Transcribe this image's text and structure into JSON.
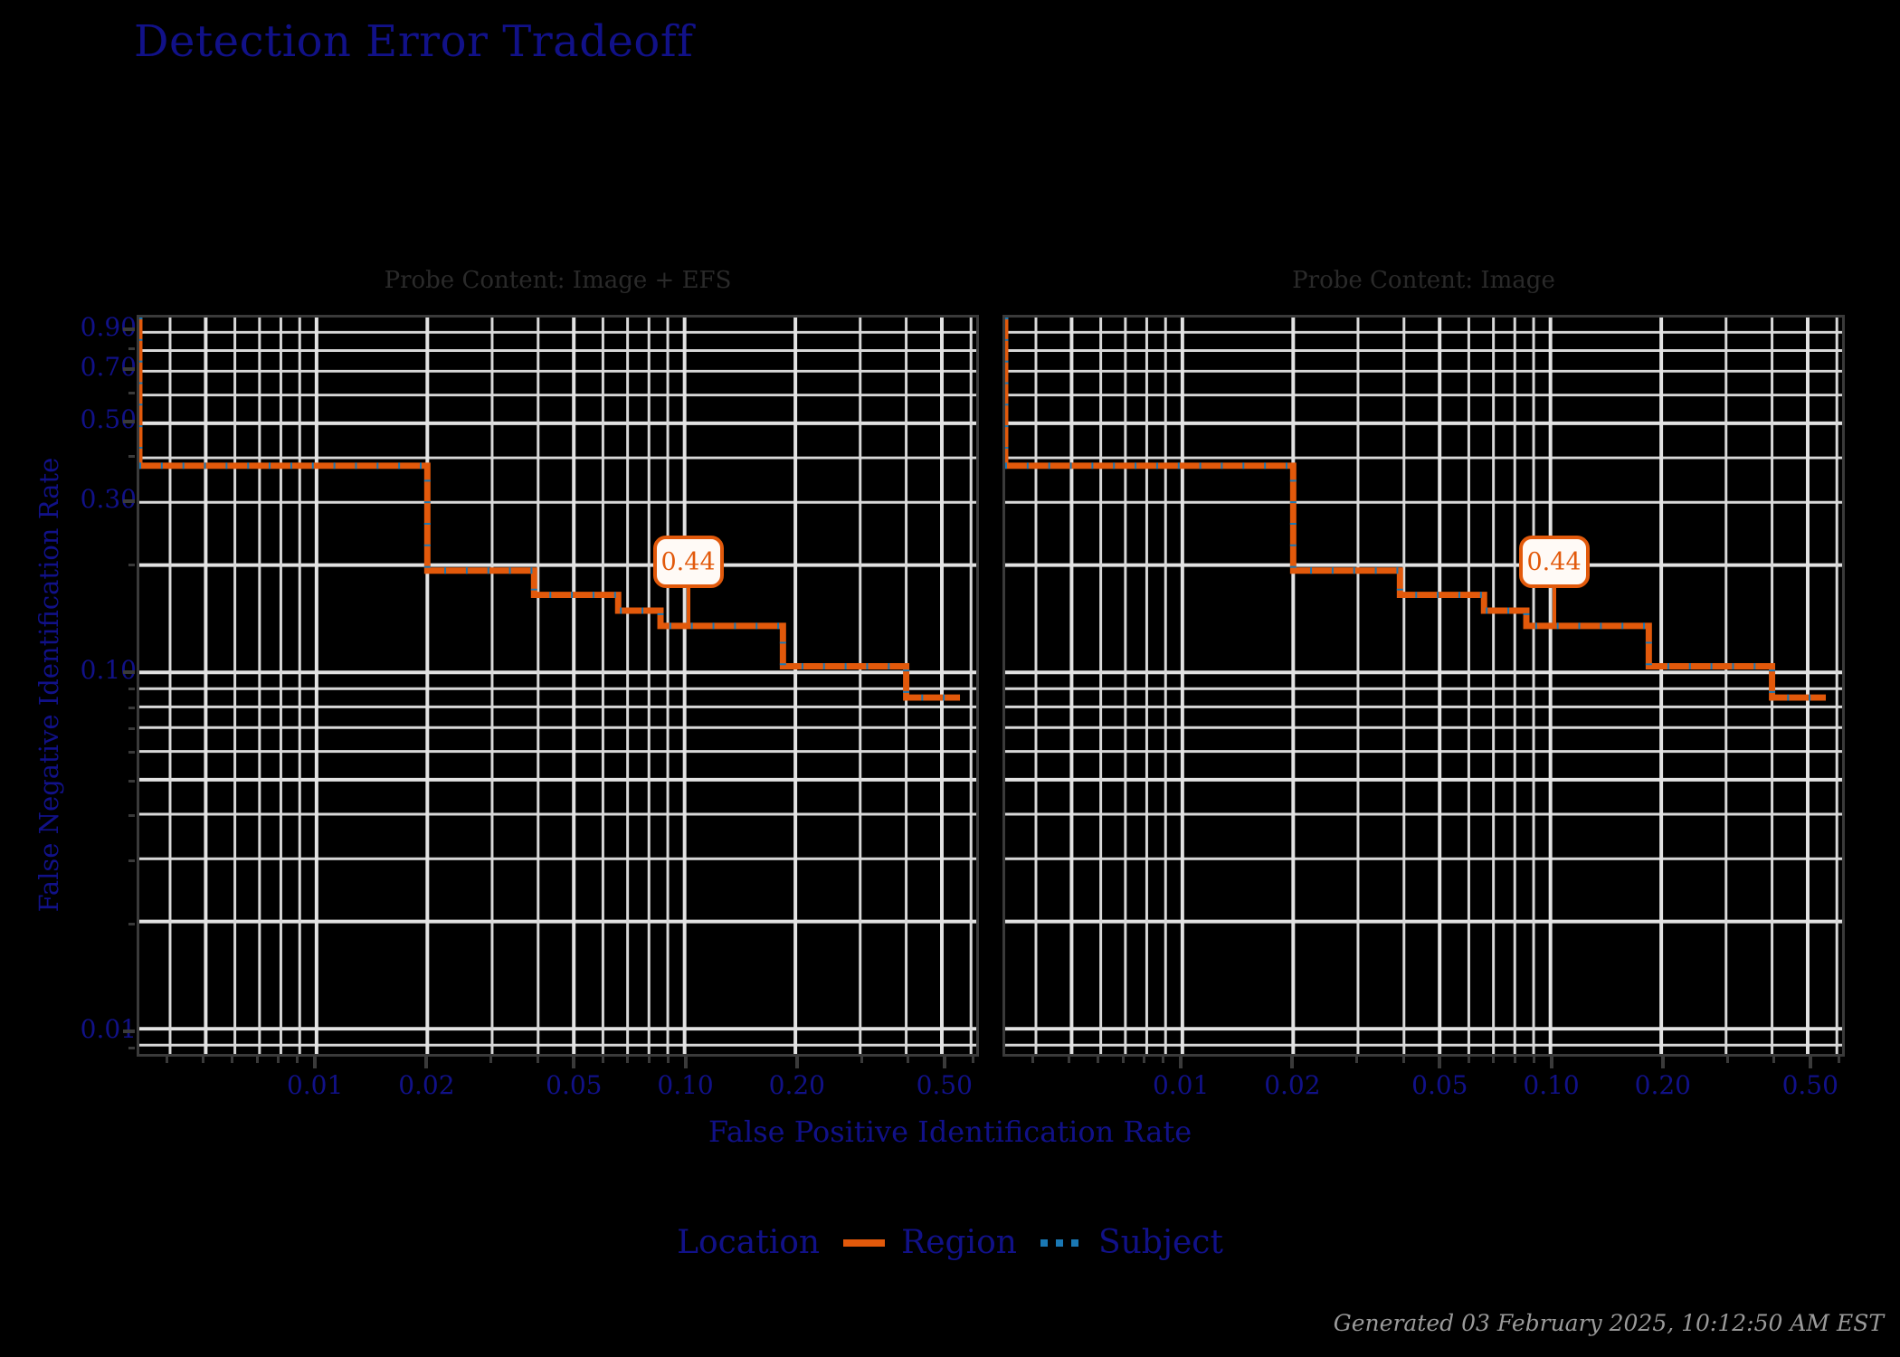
{
  "title": "Detection Error Tradeoff",
  "axes": {
    "x_title": "False Positive Identification Rate",
    "y_title": "False Negative Identification Rate",
    "x_ticks": [
      "0.01",
      "0.02",
      "0.05",
      "0.10",
      "0.20",
      "0.50"
    ],
    "y_ticks": [
      "0.90",
      "0.70",
      "0.50",
      "0.30",
      "0.10",
      "0.01"
    ]
  },
  "panels": [
    {
      "title": "Probe Content: Image + EFS"
    },
    {
      "title": "Probe Content: Image"
    }
  ],
  "legend": {
    "title": "Location",
    "items": [
      {
        "label": "Region",
        "style": "solid",
        "color": "#e2590b"
      },
      {
        "label": "Subject",
        "style": "dotted",
        "color": "#1a78b4"
      }
    ]
  },
  "annotation": {
    "label": "0.44"
  },
  "footer": "Generated 03 February 2025, 10:12:50 AM EST",
  "colors": {
    "title": "#111188",
    "axis_text": "#111188",
    "panel_title": "#2a2a2a",
    "background": "#000000",
    "grid": "#e2e2e2",
    "region": "#e2590b",
    "subject": "#1a78b4",
    "footer": "#9a9a9a"
  },
  "chart_data": {
    "type": "line",
    "title": "Detection Error Tradeoff",
    "xlabel": "False Positive Identification Rate",
    "ylabel": "False Negative Identification Rate",
    "xscale": "log",
    "yscale": "log",
    "xlim": [
      0.0033,
      0.62
    ],
    "ylim": [
      0.0085,
      0.99
    ],
    "grid": true,
    "legend_position": "bottom",
    "annotations": [
      {
        "text": "0.44",
        "x": 0.1,
        "y": 0.135,
        "panel": 0
      },
      {
        "text": "0.44",
        "x": 0.1,
        "y": 0.135,
        "panel": 1
      }
    ],
    "panels": [
      {
        "name": "Probe Content: Image + EFS",
        "series": [
          {
            "name": "Region",
            "style": "solid",
            "color": "#e2590b",
            "step": "post",
            "x": [
              0.0033,
              0.02,
              0.02,
              0.039,
              0.039,
              0.066,
              0.066,
              0.086,
              0.086,
              0.185,
              0.185,
              0.4,
              0.4,
              0.56
            ],
            "y": [
              0.38,
              0.38,
              0.193,
              0.193,
              0.165,
              0.165,
              0.149,
              0.149,
              0.135,
              0.135,
              0.104,
              0.104,
              0.085,
              0.085
            ]
          },
          {
            "name": "Subject",
            "style": "dotted",
            "color": "#1a78b4",
            "step": "post",
            "x": [
              0.0033,
              0.02,
              0.02,
              0.039,
              0.039,
              0.066,
              0.066,
              0.086,
              0.086,
              0.185,
              0.185,
              0.4,
              0.4,
              0.56
            ],
            "y": [
              0.38,
              0.38,
              0.193,
              0.193,
              0.165,
              0.165,
              0.149,
              0.149,
              0.135,
              0.135,
              0.104,
              0.104,
              0.085,
              0.085
            ]
          }
        ]
      },
      {
        "name": "Probe Content: Image",
        "series": [
          {
            "name": "Region",
            "style": "solid",
            "color": "#e2590b",
            "step": "post",
            "x": [
              0.0033,
              0.02,
              0.02,
              0.039,
              0.039,
              0.066,
              0.066,
              0.086,
              0.086,
              0.185,
              0.185,
              0.4,
              0.4,
              0.56
            ],
            "y": [
              0.38,
              0.38,
              0.193,
              0.193,
              0.165,
              0.165,
              0.149,
              0.149,
              0.135,
              0.135,
              0.104,
              0.104,
              0.085,
              0.085
            ]
          },
          {
            "name": "Subject",
            "style": "dotted",
            "color": "#1a78b4",
            "step": "post",
            "x": [
              0.0033,
              0.02,
              0.02,
              0.039,
              0.039,
              0.066,
              0.066,
              0.086,
              0.086,
              0.185,
              0.185,
              0.4,
              0.4,
              0.56
            ],
            "y": [
              0.38,
              0.38,
              0.193,
              0.193,
              0.165,
              0.165,
              0.149,
              0.149,
              0.135,
              0.135,
              0.104,
              0.104,
              0.085,
              0.085
            ]
          }
        ]
      }
    ]
  }
}
